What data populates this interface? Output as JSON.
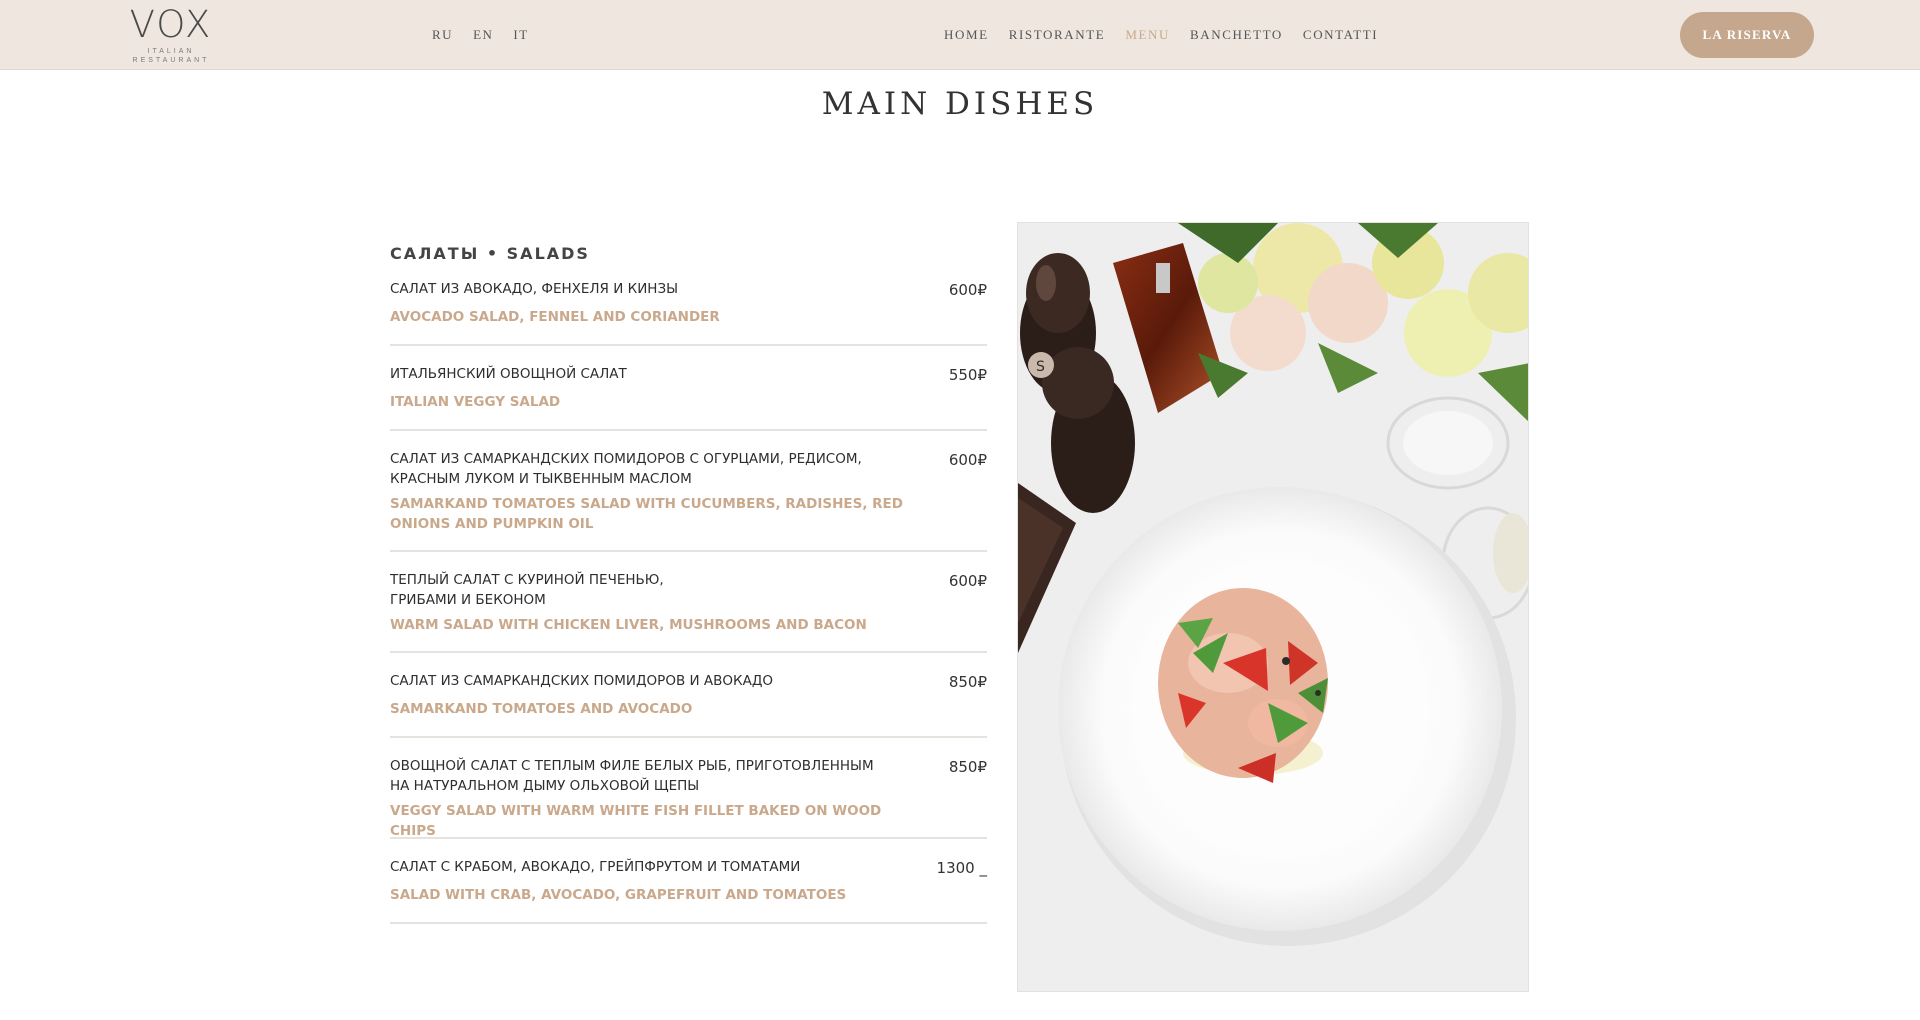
{
  "header": {
    "logo_main": "VOX",
    "logo_sub": "ITALIAN RESTAURANT",
    "languages": [
      "RU",
      "EN",
      "IT"
    ],
    "nav": [
      {
        "label": "HOME",
        "active": false
      },
      {
        "label": "RISTORANTE",
        "active": false
      },
      {
        "label": "MENU",
        "active": true
      },
      {
        "label": "BANCHETTO",
        "active": false
      },
      {
        "label": "CONTATTI",
        "active": false
      }
    ],
    "reserve_label": "LA RISERVA"
  },
  "page": {
    "title": "MAIN DISHES"
  },
  "menu": {
    "section_title": "САЛАТЫ • SALADS",
    "items": [
      {
        "ru": "САЛАТ ИЗ АВОКАДО, ФЕНХЕЛЯ И КИНЗЫ",
        "en": "AVOCADO SALAD, FENNEL AND CORIANDER",
        "price": "600₽"
      },
      {
        "ru": "ИТАЛЬЯНСКИЙ ОВОЩНОЙ САЛАТ",
        "en": "ITALIAN VEGGY SALAD",
        "price": "550₽"
      },
      {
        "ru": "САЛАТ ИЗ САМАРКАНДСКИХ ПОМИДОРОВ С ОГУРЦАМИ, РЕДИСОМ, КРАСНЫМ ЛУКОМ И ТЫКВЕННЫМ МАСЛОМ",
        "en": "SAMARKAND TOMATOES SALAD WITH CUCUMBERS, RADISHES, RED ONIONS AND PUMPKIN OIL",
        "price": "600₽"
      },
      {
        "ru": "ТЕПЛЫЙ САЛАТ С КУРИНОЙ ПЕЧЕНЬЮ, ГРИБАМИ И БЕКОНОМ",
        "en": "WARM SALAD WITH CHICKEN LIVER, MUSHROOMS AND BACON",
        "price": "600₽"
      },
      {
        "ru": "САЛАТ ИЗ САМАРКАНДСКИХ ПОМИДОРОВ И АВОКАДО",
        "en": "SAMARKAND TOMATOES AND AVOCADO",
        "price": "850₽"
      },
      {
        "ru": "ОВОЩНОЙ САЛАТ С ТЕПЛЫМ ФИЛЕ БЕЛЫХ РЫБ, ПРИГОТОВЛЕННЫМ НА НАТУРАЛЬНОМ ДЫМУ ОЛЬХОВОЙ ЩЕПЫ",
        "en": "VEGGY SALAD WITH WARM WHITE FISH FILLET BAKED ON WOOD CHIPS",
        "price": "850₽"
      },
      {
        "ru": "САЛАТ С КРАБОМ, АВОКАДО, ГРЕЙПФРУТОМ И ТОМАТАМИ",
        "en": "SALAD WITH CRAB, AVOCADO, GRAPEFRUIT AND TOMATOES",
        "price": "1300 _"
      }
    ]
  },
  "colors": {
    "accent": "#c9a88b",
    "header_bg": "#efe7df",
    "button_bg": "#c4a78c"
  }
}
